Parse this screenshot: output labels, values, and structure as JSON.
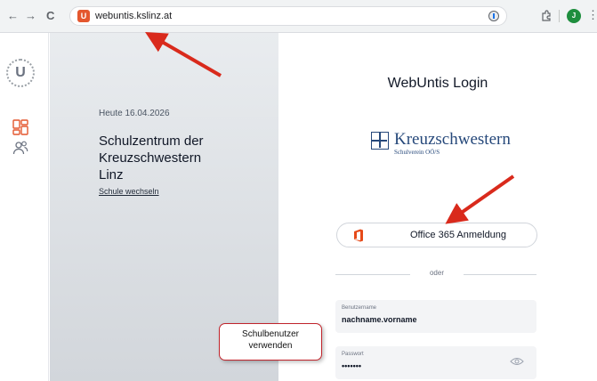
{
  "browser": {
    "url": "webuntis.kslinz.at",
    "site_icon": "U",
    "profile_letter": "J",
    "back_icon": "←",
    "forward_icon": "→",
    "reload_icon": "C",
    "menu_icon": "⋮"
  },
  "app_sidebar": {
    "logo_letter": "U",
    "icons": [
      "dashboard-icon",
      "users-icon"
    ]
  },
  "left_panel": {
    "date": "Heute 16.04.2026",
    "school_line1": "Schulzentrum der",
    "school_line2": "Kreuzschwestern",
    "school_line3": "Linz",
    "switch_link": "Schule wechseln"
  },
  "login": {
    "title": "WebUntis Login",
    "brand_name": "Kreuzschwestern",
    "brand_sub": "Schulverein OÖ/S",
    "office_button": "Office 365 Anmeldung",
    "divider": "oder",
    "username_label": "Benutzername",
    "username_value": "nachname.vorname",
    "password_label": "Passwort",
    "password_value": "•••••••"
  },
  "annotation": {
    "callout_line1": "Schulbenutzer",
    "callout_line2": "verwenden"
  },
  "colors": {
    "accent_red": "#d92a1c",
    "brand_blue": "#27497b",
    "office_orange": "#e64a19"
  }
}
